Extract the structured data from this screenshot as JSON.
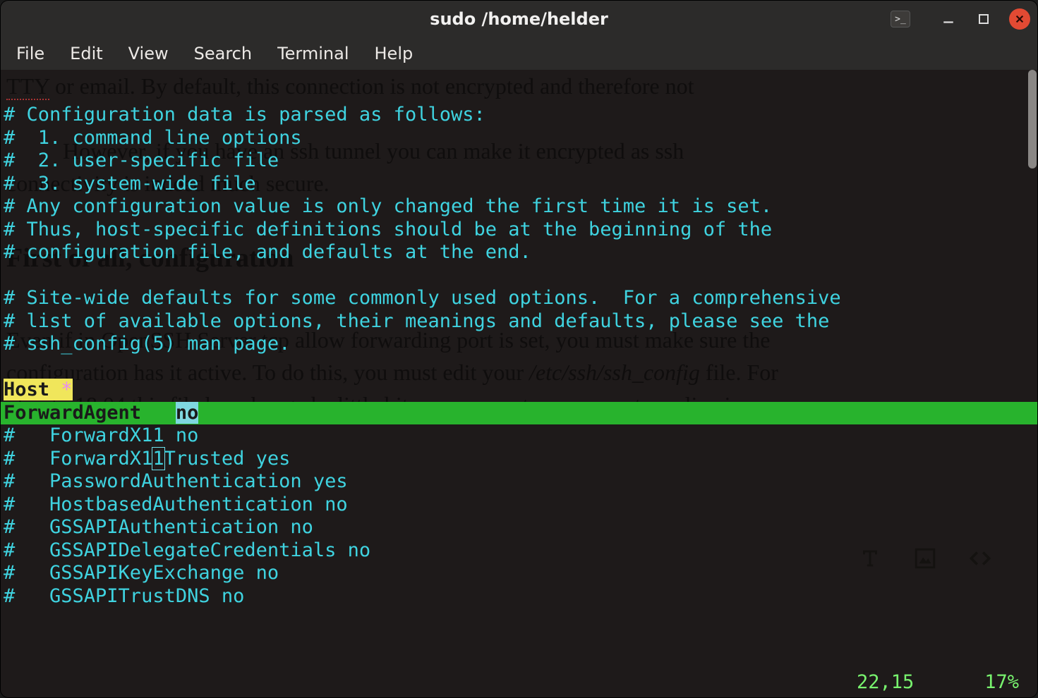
{
  "window": {
    "title": "sudo  /home/helder"
  },
  "menu": {
    "items": [
      "File",
      "Edit",
      "View",
      "Search",
      "Terminal",
      "Help"
    ]
  },
  "editor": {
    "lines": [
      {
        "type": "comment",
        "text": "# Configuration data is parsed as follows:"
      },
      {
        "type": "comment",
        "text": "#  1. command line options"
      },
      {
        "type": "comment",
        "text": "#  2. user-specific file"
      },
      {
        "type": "comment",
        "text": "#  3. system-wide file"
      },
      {
        "type": "comment",
        "text": "# Any configuration value is only changed the first time it is set."
      },
      {
        "type": "comment",
        "text": "# Thus, host-specific definitions should be at the beginning of the"
      },
      {
        "type": "comment",
        "text": "# configuration file, and defaults at the end."
      },
      {
        "type": "blank",
        "text": ""
      },
      {
        "type": "comment",
        "text": "# Site-wide defaults for some commonly used options.  For a comprehensive"
      },
      {
        "type": "comment",
        "text": "# list of available options, their meanings and defaults, please see the"
      },
      {
        "type": "comment",
        "text": "# ssh_config(5) man page."
      },
      {
        "type": "blank",
        "text": ""
      }
    ],
    "host_key": "Host",
    "host_star": "*",
    "cursorline": {
      "keyword": "ForwardAgent",
      "spacer": "   ",
      "value": "no"
    },
    "after": [
      "#   ForwardX11 no",
      "#   ForwardX11Trusted yes",
      "#   PasswordAuthentication yes",
      "#   HostbasedAuthentication no",
      "#   GSSAPIAuthentication no",
      "#   GSSAPIDelegateCredentials no",
      "#   GSSAPIKeyExchange no",
      "#   GSSAPITrustDNS no"
    ],
    "after_boxed_index": 1,
    "after_boxed_char": 13
  },
  "status": {
    "pos": "22,15",
    "pct": "17%"
  },
  "background_doc": {
    "l0a": "TTY",
    "l0b": " or email. By default, this connection is not encrypted and therefore not",
    "l1": "          However, if you have an ssh tunnel you can make it encrypted as ssh",
    "l2": "connectivity is indeed much secure."
  }
}
